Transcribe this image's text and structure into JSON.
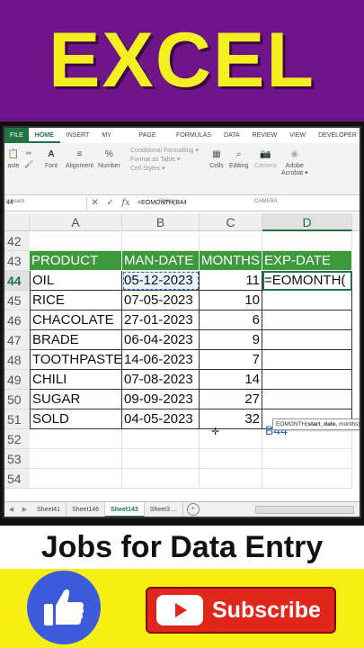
{
  "banner": {
    "title": "EXCEL"
  },
  "ribbon": {
    "tabs": [
      "FILE",
      "HOME",
      "INSERT",
      "MY CHOICE",
      "PAGE LAYOUT",
      "FORMULAS",
      "DATA",
      "REVIEW",
      "VIEW",
      "DEVELOPER"
    ],
    "active_tab": "HOME",
    "buttons": {
      "paste": "aste",
      "font": "Font",
      "alignment": "Alignment",
      "number": "Number",
      "cells": "Cells",
      "editing": "Editing",
      "camera": "Camera",
      "adobe": "Adobe",
      "acrobat": "Acrobat ▾"
    },
    "styles_items": [
      "Conditional Formatting ▾",
      "Format as Table ▾",
      "Cell Styles ▾"
    ],
    "group_labels": {
      "clipboard": "ipboard",
      "styles": "Styles",
      "camera": "CAMERA"
    }
  },
  "formula_bar": {
    "name_box": "44",
    "icons": [
      "✕",
      "✓",
      "fx"
    ],
    "content": "=EOMONTH(B44"
  },
  "grid": {
    "columns": [
      "A",
      "B",
      "C",
      "D"
    ],
    "selected_column": "D",
    "rows": [
      {
        "num": "42",
        "cells": [
          "",
          "",
          "",
          ""
        ]
      },
      {
        "num": "43",
        "cells": [
          "PRODUCT",
          "MAN-DATE",
          "MONTHS",
          "EXP-DATE"
        ]
      },
      {
        "num": "44",
        "cells": [
          "OIL",
          "05-12-2023",
          "11",
          "=EOMONTH("
        ]
      },
      {
        "num": "45",
        "cells": [
          "RICE",
          "07-05-2023",
          "10",
          ""
        ]
      },
      {
        "num": "46",
        "cells": [
          "CHACOLATE",
          "27-01-2023",
          "6",
          ""
        ]
      },
      {
        "num": "47",
        "cells": [
          "BRADE",
          "06-04-2023",
          "9",
          ""
        ]
      },
      {
        "num": "48",
        "cells": [
          "TOOTHPASTE",
          "14-06-2023",
          "7",
          ""
        ]
      },
      {
        "num": "49",
        "cells": [
          "CHILI",
          "07-08-2023",
          "14",
          ""
        ]
      },
      {
        "num": "50",
        "cells": [
          "SUGAR",
          "09-09-2023",
          "27",
          ""
        ]
      },
      {
        "num": "51",
        "cells": [
          "SOLD",
          "04-05-2023",
          "32",
          ""
        ]
      },
      {
        "num": "52",
        "cells": [
          "",
          "",
          "",
          ""
        ]
      },
      {
        "num": "53",
        "cells": [
          "",
          "",
          "",
          ""
        ]
      },
      {
        "num": "54",
        "cells": [
          "",
          "",
          "",
          ""
        ]
      }
    ],
    "tooltip": {
      "fn": "EOMONTH(",
      "arg1": "start_date",
      "rest": ", months)"
    },
    "floating_ref": "B44"
  },
  "sheets": {
    "tabs": [
      "Sheet41",
      "Sheet146",
      "Sheet143",
      "Sheet3 ..."
    ],
    "active": "Sheet143",
    "add": "+"
  },
  "footer": {
    "jobs_text": "Jobs for Data Entry",
    "subscribe_label": "Subscribe"
  },
  "colors": {
    "banner_bg": "#6f1489",
    "banner_text": "#f4ef20",
    "header_green": "#3d9a3c",
    "subscribe_red": "#e1261c",
    "like_blue": "#3b5bdb",
    "bottom_yellow": "#f5ef14"
  }
}
